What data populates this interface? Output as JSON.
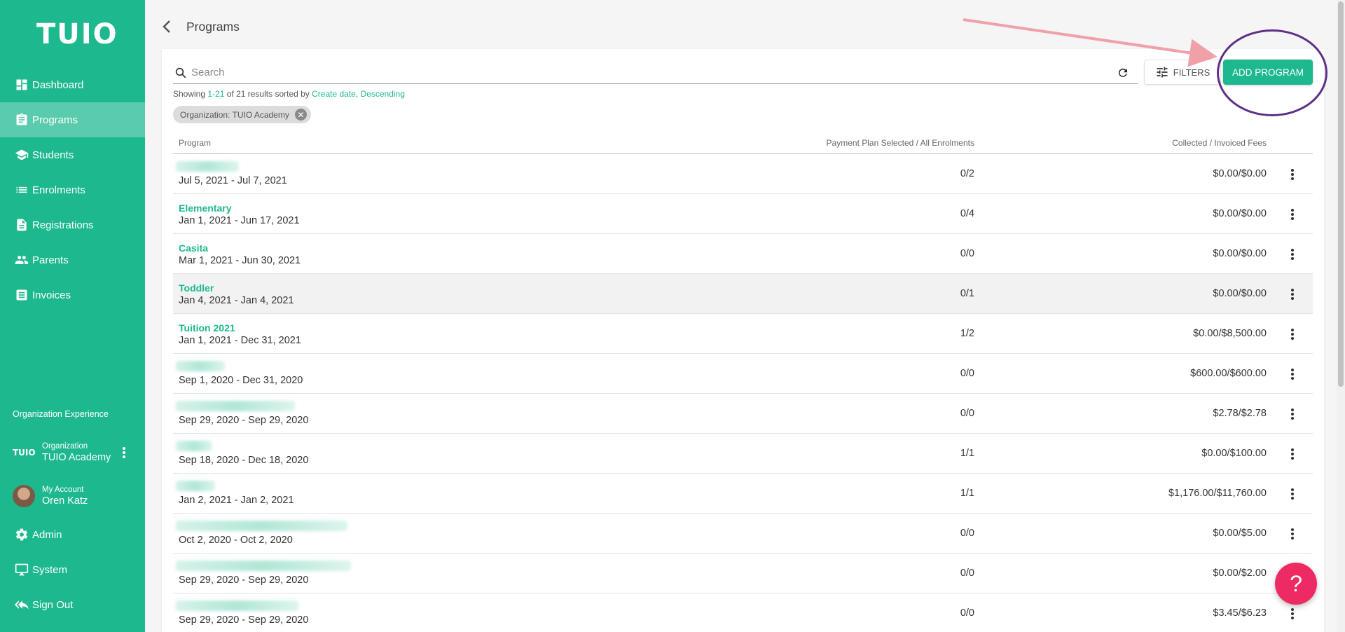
{
  "app": {
    "logo_text": "TUIO"
  },
  "sidebar": {
    "items": [
      {
        "label": "Dashboard",
        "icon": "dashboard-icon"
      },
      {
        "label": "Programs",
        "icon": "clipboard-icon",
        "active": true
      },
      {
        "label": "Students",
        "icon": "graduation-cap-icon"
      },
      {
        "label": "Enrolments",
        "icon": "list-icon"
      },
      {
        "label": "Registrations",
        "icon": "document-icon"
      },
      {
        "label": "Parents",
        "icon": "people-icon"
      },
      {
        "label": "Invoices",
        "icon": "invoice-icon"
      }
    ],
    "org_experience_label": "Organization Experience",
    "organization": {
      "logo_text": "TUIO",
      "label": "Organization",
      "name": "TUIO Academy"
    },
    "account": {
      "label": "My Account",
      "name": "Oren Katz"
    },
    "bottom_items": [
      {
        "label": "Admin",
        "icon": "gear-icon"
      },
      {
        "label": "System",
        "icon": "monitor-icon"
      },
      {
        "label": "Sign Out",
        "icon": "sign-out-icon"
      }
    ]
  },
  "header": {
    "title": "Programs"
  },
  "toolbar": {
    "search_placeholder": "Search",
    "filters_label": "FILTERS",
    "add_label": "ADD PROGRAM"
  },
  "results": {
    "prefix": "Showing ",
    "range": "1-21",
    "middle": " of 21 results sorted by ",
    "sort_field": "Create date",
    "comma": ", ",
    "sort_dir": "Descending"
  },
  "filter_chip": {
    "label": "Organization: TUIO Academy"
  },
  "table": {
    "columns": {
      "program": "Program",
      "payment": "Payment Plan Selected / All Enrolments",
      "fees": "Collected / Invoiced Fees"
    },
    "rows": [
      {
        "name": "",
        "dates": "Jul 5, 2021 - Jul 7, 2021",
        "payment": "0/2",
        "fees": "$0.00/$0.00"
      },
      {
        "name": "Elementary",
        "dates": "Jan 1, 2021 - Jun 17, 2021",
        "payment": "0/4",
        "fees": "$0.00/$0.00"
      },
      {
        "name": "Casita",
        "dates": "Mar 1, 2021 - Jun 30, 2021",
        "payment": "0/0",
        "fees": "$0.00/$0.00"
      },
      {
        "name": "Toddler",
        "dates": "Jan 4, 2021 - Jan 4, 2021",
        "payment": "0/1",
        "fees": "$0.00/$0.00"
      },
      {
        "name": "Tuition 2021",
        "dates": "Jan 1, 2021 - Dec 31, 2021",
        "payment": "1/2",
        "fees": "$0.00/$8,500.00"
      },
      {
        "name": "",
        "dates": "Sep 1, 2020 - Dec 31, 2020",
        "payment": "0/0",
        "fees": "$600.00/$600.00"
      },
      {
        "name": "",
        "dates": "Sep 29, 2020 - Sep 29, 2020",
        "payment": "0/0",
        "fees": "$2.78/$2.78"
      },
      {
        "name": "",
        "dates": "Sep 18, 2020 - Dec 18, 2020",
        "payment": "1/1",
        "fees": "$0.00/$100.00"
      },
      {
        "name": "",
        "dates": "Jan 2, 2021 - Jan 2, 2021",
        "payment": "1/1",
        "fees": "$1,176.00/$11,760.00"
      },
      {
        "name": "",
        "dates": "Oct 2, 2020 - Oct 2, 2020",
        "payment": "0/0",
        "fees": "$0.00/$5.00"
      },
      {
        "name": "",
        "dates": "Sep 29, 2020 - Sep 29, 2020",
        "payment": "0/0",
        "fees": "$0.00/$2.00"
      },
      {
        "name": "",
        "dates": "Sep 29, 2020 - Sep 29, 2020",
        "payment": "0/0",
        "fees": "$3.45/$6.23"
      }
    ]
  },
  "help": {
    "label": "?"
  },
  "colors": {
    "brand": "#1db88e",
    "help": "#ee2a63",
    "annotation": "#5e2f87",
    "arrow": "#f0a0a8"
  }
}
